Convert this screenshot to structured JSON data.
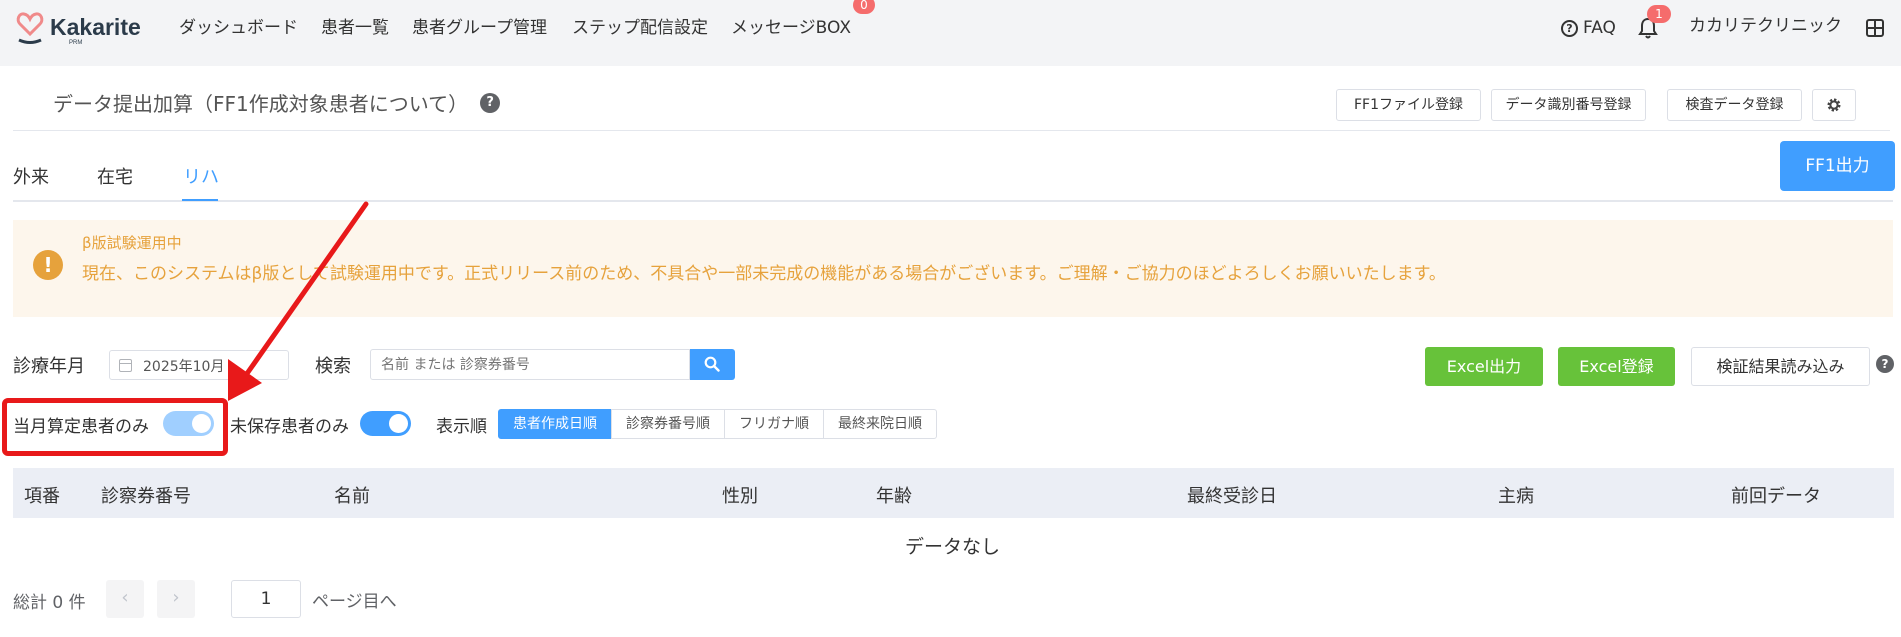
{
  "topnav": {
    "logo_text": "Kakarite",
    "logo_sub": "PRM",
    "items": [
      {
        "label": "ダッシュボード"
      },
      {
        "label": "患者一覧"
      },
      {
        "label": "患者グループ管理"
      },
      {
        "label": "ステップ配信設定"
      },
      {
        "label": "メッセージBOX",
        "badge": "0"
      }
    ],
    "faq_label": "FAQ",
    "notification_badge": "1",
    "clinic_name": "カカリテクリニック",
    "accent_color": "#f56c6c"
  },
  "page": {
    "title": "データ提出加算（FF1作成対象患者について）",
    "header_buttons": {
      "ff1_file": "FF1ファイル登録",
      "data_id": "データ識別番号登録",
      "exam_data": "検査データ登録"
    }
  },
  "tabs": [
    {
      "label": "外来",
      "active": false
    },
    {
      "label": "在宅",
      "active": false
    },
    {
      "label": "リハ",
      "active": true
    }
  ],
  "ff1_output_label": "FF1出力",
  "alert": {
    "title": "β版試験運用中",
    "description": "現在、このシステムはβ版として試験運用中です。正式リリース前のため、不具合や一部未完成の機能がある場合がございます。ご理解・ご協力のほどよろしくお願いいたします。",
    "color": "#e6a23c"
  },
  "filters": {
    "month_label": "診療年月",
    "month_value": "2025年10月",
    "search_label": "検索",
    "search_placeholder": "名前 または 診察券番号",
    "current_month_only_label": "当月算定患者のみ",
    "current_month_only_on": true,
    "unsaved_only_label": "未保存患者のみ",
    "unsaved_only_on": true,
    "sort_label": "表示順",
    "sort_options": [
      "患者作成日順",
      "診察券番号順",
      "フリガナ順",
      "最終来院日順"
    ],
    "sort_selected": "患者作成日順"
  },
  "actions": {
    "excel_export": "Excel出力",
    "excel_import": "Excel登録",
    "verify_import": "検証結果読み込み"
  },
  "table": {
    "columns": [
      "項番",
      "診察券番号",
      "名前",
      "性別",
      "年齢",
      "最終受診日",
      "主病",
      "前回データ"
    ],
    "empty_text": "データなし"
  },
  "pagination": {
    "total_text": "総計 0 件",
    "page": "1",
    "goto_suffix": "ページ目へ"
  }
}
